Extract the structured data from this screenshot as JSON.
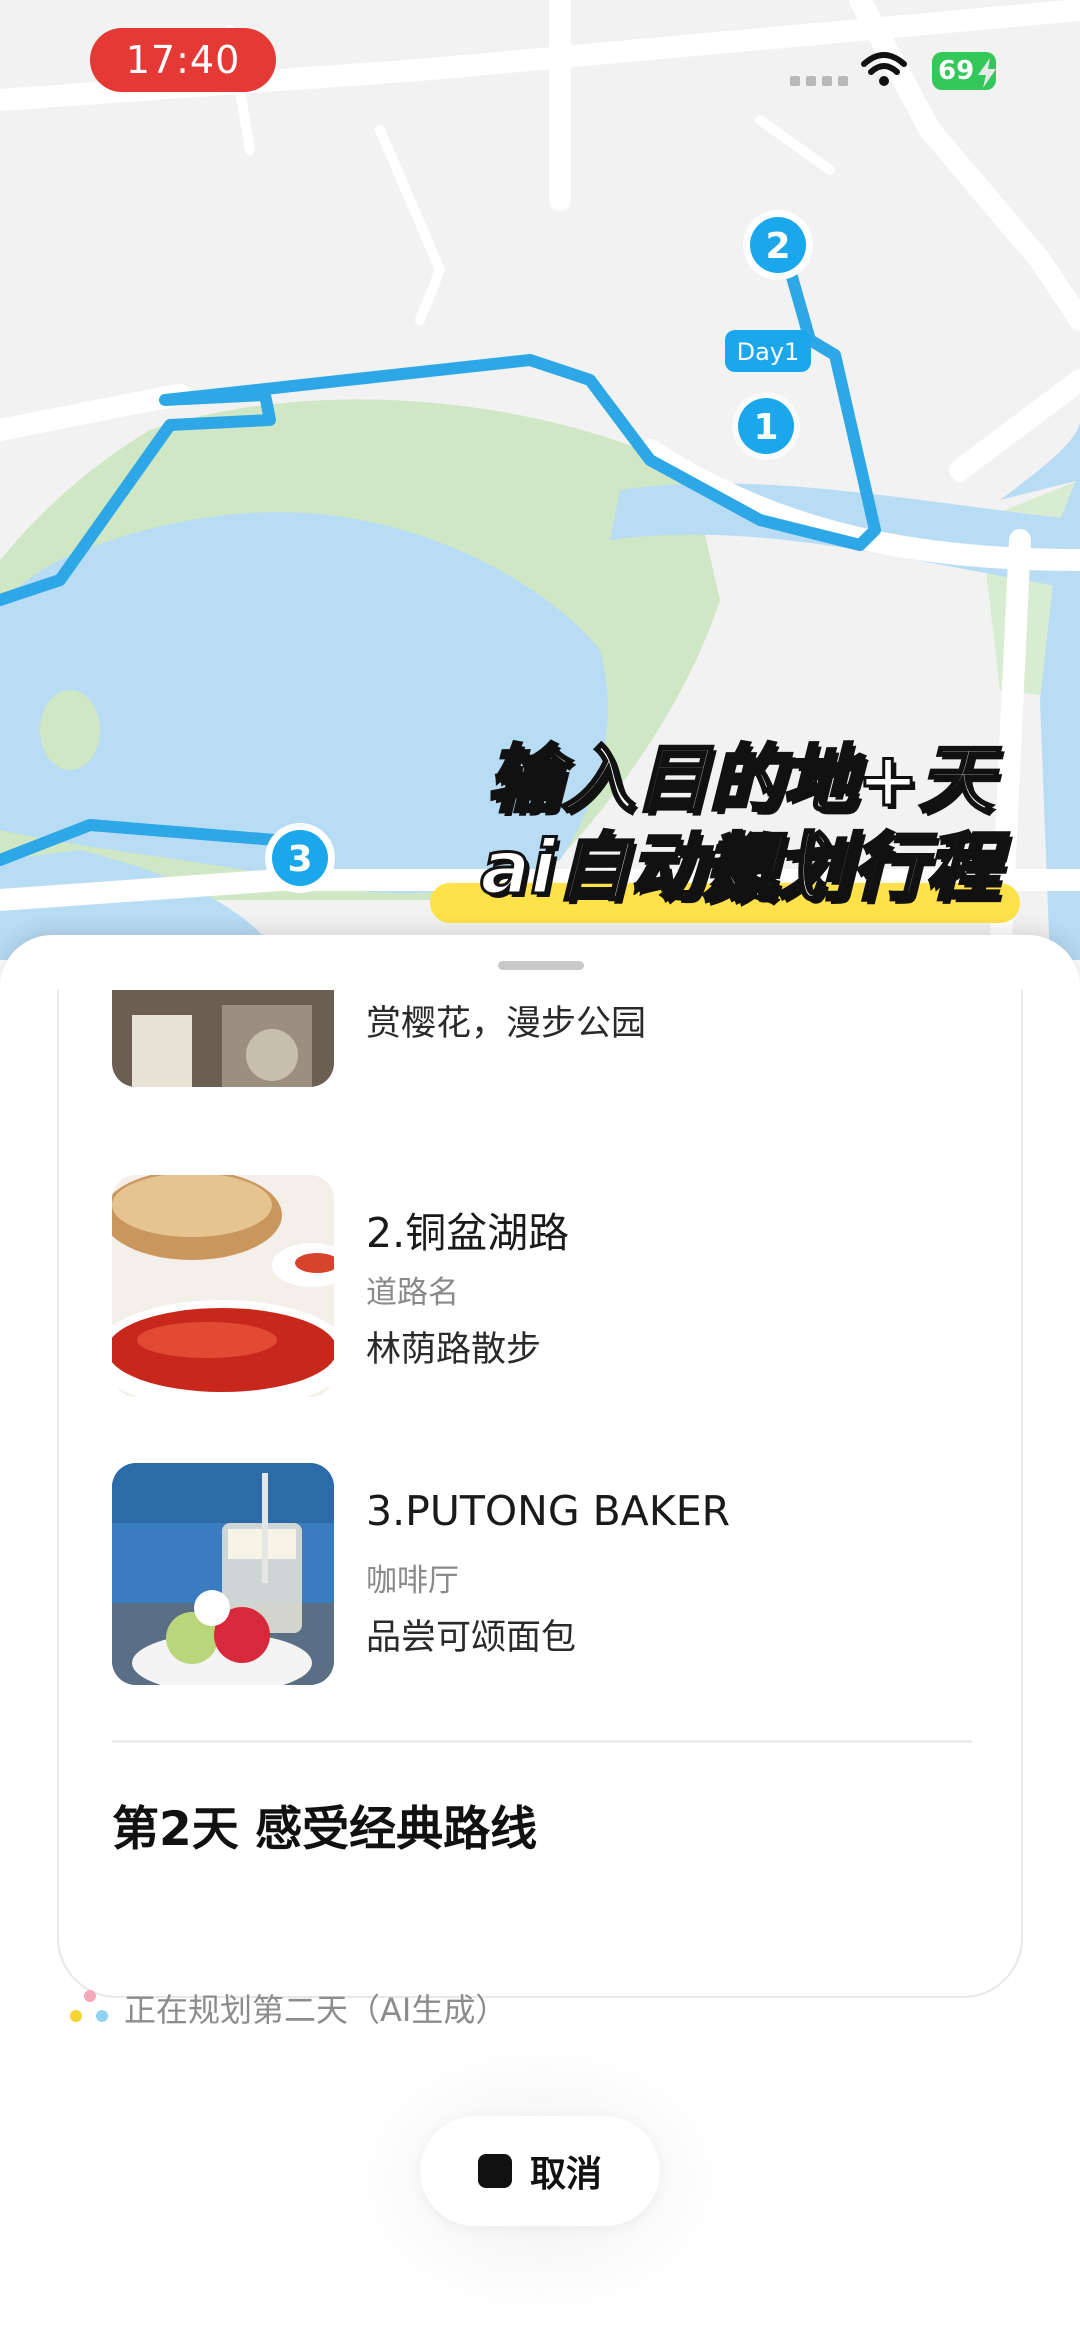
{
  "status_bar": {
    "time": "17:40",
    "battery": "69"
  },
  "map": {
    "markers": [
      "1",
      "2",
      "3"
    ],
    "day_label": "Day1"
  },
  "promo": {
    "line1": "输入目的地+天数",
    "line2": "ai自动规划行程"
  },
  "itinerary": {
    "partial_item_desc": "赏樱花，漫步公园",
    "items": [
      {
        "title": "2.铜盆湖路",
        "category": "道路名",
        "desc": "林荫路散步"
      },
      {
        "title": "3.PUTONG BAKER",
        "category": "咖啡厅",
        "desc": "品尝可颂面包"
      }
    ],
    "day2_title": "第2天 感受经典路线"
  },
  "planning_status": "正在规划第二天（AI生成）",
  "cancel_label": "取消",
  "colors": {
    "route": "#2ea7e6",
    "marker": "#1aa7ec",
    "time_pill": "#e53935",
    "battery": "#34c759",
    "promo_bar": "#ffe14a"
  }
}
